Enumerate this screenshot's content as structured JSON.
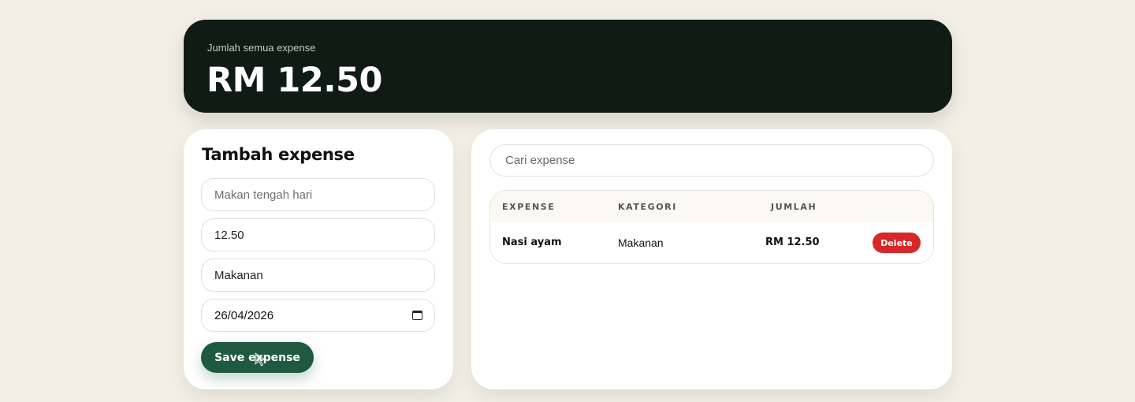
{
  "summary": {
    "label": "Jumlah semua expense",
    "total": "RM 12.50"
  },
  "form": {
    "title": "Tambah expense",
    "name_placeholder": "Makan tengah hari",
    "amount_value": "12.50",
    "category_value": "Makanan",
    "date_value": "26/04/2026",
    "save_label": "Save expense"
  },
  "search": {
    "placeholder": "Cari expense"
  },
  "table": {
    "headers": [
      "EXPENSE",
      "KATEGORI",
      "JUMLAH"
    ],
    "rows": [
      {
        "expense": "Nasi ayam",
        "kategori": "Makanan",
        "jumlah": "RM 12.50",
        "delete_label": "Delete"
      }
    ]
  },
  "icons": {
    "date": "calendar-icon",
    "cursor": "mouse-pointer-icon"
  },
  "colors": {
    "background": "#f3efe7",
    "summary_bg": "#111b16",
    "primary": "#1f5a40",
    "danger": "#d62828"
  }
}
